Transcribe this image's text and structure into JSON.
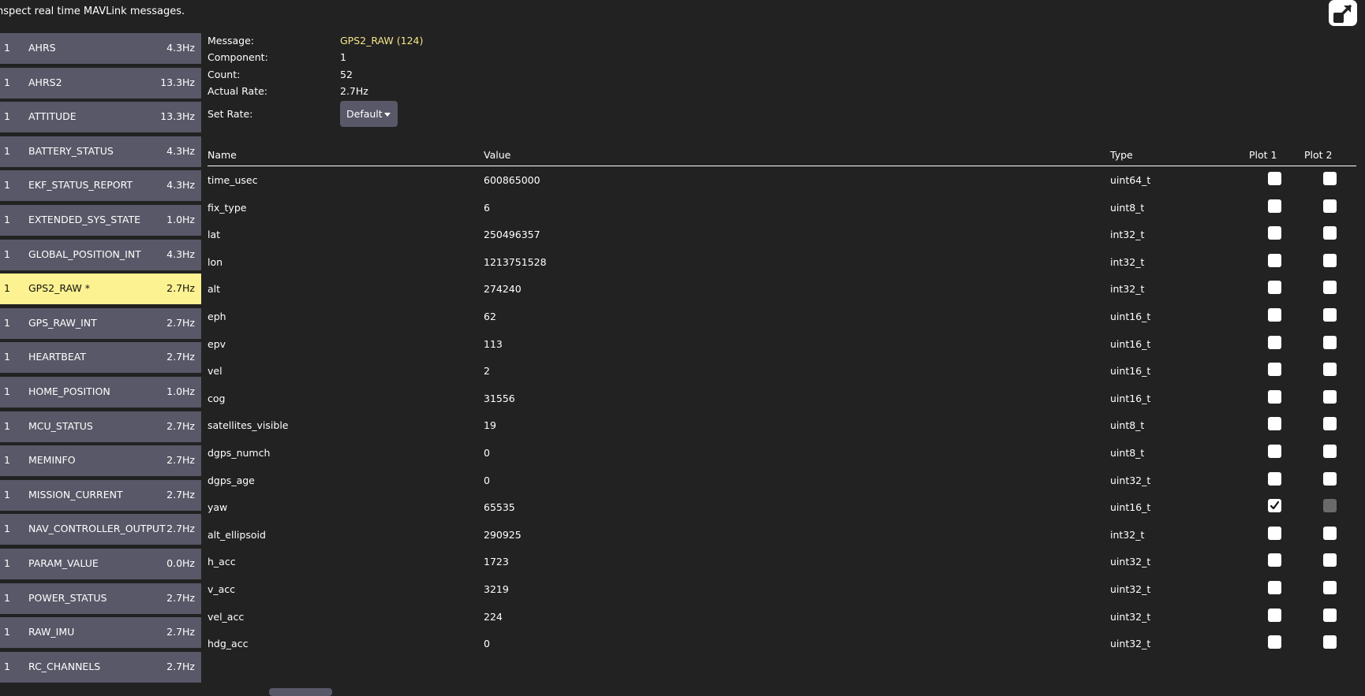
{
  "header": {
    "description": "nspect real time MAVLink messages."
  },
  "icons": {
    "popout": "popout-icon",
    "dropdown": "caret-down-icon",
    "check": "checkmark-icon"
  },
  "colors": {
    "background": "#222222",
    "item_bg": "#585868",
    "selected_bg": "#fdf291",
    "message_name": "#f5e58a"
  },
  "messages": [
    {
      "comp": "1",
      "name": "AHRS",
      "rate": "4.3Hz"
    },
    {
      "comp": "1",
      "name": "AHRS2",
      "rate": "13.3Hz"
    },
    {
      "comp": "1",
      "name": "ATTITUDE",
      "rate": "13.3Hz"
    },
    {
      "comp": "1",
      "name": "BATTERY_STATUS",
      "rate": "4.3Hz"
    },
    {
      "comp": "1",
      "name": "EKF_STATUS_REPORT",
      "rate": "4.3Hz"
    },
    {
      "comp": "1",
      "name": "EXTENDED_SYS_STATE",
      "rate": "1.0Hz"
    },
    {
      "comp": "1",
      "name": "GLOBAL_POSITION_INT",
      "rate": "4.3Hz"
    },
    {
      "comp": "1",
      "name": "GPS2_RAW *",
      "rate": "2.7Hz",
      "selected": true
    },
    {
      "comp": "1",
      "name": "GPS_RAW_INT",
      "rate": "2.7Hz"
    },
    {
      "comp": "1",
      "name": "HEARTBEAT",
      "rate": "2.7Hz"
    },
    {
      "comp": "1",
      "name": "HOME_POSITION",
      "rate": "1.0Hz"
    },
    {
      "comp": "1",
      "name": "MCU_STATUS",
      "rate": "2.7Hz"
    },
    {
      "comp": "1",
      "name": "MEMINFO",
      "rate": "2.7Hz"
    },
    {
      "comp": "1",
      "name": "MISSION_CURRENT",
      "rate": "2.7Hz"
    },
    {
      "comp": "1",
      "name": "NAV_CONTROLLER_OUTPUT",
      "rate": "2.7Hz"
    },
    {
      "comp": "1",
      "name": "PARAM_VALUE",
      "rate": "0.0Hz"
    },
    {
      "comp": "1",
      "name": "POWER_STATUS",
      "rate": "2.7Hz"
    },
    {
      "comp": "1",
      "name": "RAW_IMU",
      "rate": "2.7Hz"
    },
    {
      "comp": "1",
      "name": "RC_CHANNELS",
      "rate": "2.7Hz"
    }
  ],
  "info": {
    "message_label": "Message:",
    "message_value": "GPS2_RAW (124)",
    "component_label": "Component:",
    "component_value": "1",
    "count_label": "Count:",
    "count_value": "52",
    "actual_rate_label": "Actual Rate:",
    "actual_rate_value": "2.7Hz",
    "set_rate_label": "Set Rate:",
    "set_rate_value": "Default"
  },
  "table": {
    "headers": {
      "name": "Name",
      "value": "Value",
      "type": "Type",
      "plot1": "Plot 1",
      "plot2": "Plot 2"
    },
    "rows": [
      {
        "name": "time_usec",
        "value": "600865000",
        "type": "uint64_t",
        "plot1": false,
        "plot2": false
      },
      {
        "name": "fix_type",
        "value": "6",
        "type": "uint8_t",
        "plot1": false,
        "plot2": false
      },
      {
        "name": "lat",
        "value": "250496357",
        "type": "int32_t",
        "plot1": false,
        "plot2": false
      },
      {
        "name": "lon",
        "value": "1213751528",
        "type": "int32_t",
        "plot1": false,
        "plot2": false
      },
      {
        "name": "alt",
        "value": "274240",
        "type": "int32_t",
        "plot1": false,
        "plot2": false
      },
      {
        "name": "eph",
        "value": "62",
        "type": "uint16_t",
        "plot1": false,
        "plot2": false
      },
      {
        "name": "epv",
        "value": "113",
        "type": "uint16_t",
        "plot1": false,
        "plot2": false
      },
      {
        "name": "vel",
        "value": "2",
        "type": "uint16_t",
        "plot1": false,
        "plot2": false
      },
      {
        "name": "cog",
        "value": "31556",
        "type": "uint16_t",
        "plot1": false,
        "plot2": false
      },
      {
        "name": "satellites_visible",
        "value": "19",
        "type": "uint8_t",
        "plot1": false,
        "plot2": false
      },
      {
        "name": "dgps_numch",
        "value": "0",
        "type": "uint8_t",
        "plot1": false,
        "plot2": false
      },
      {
        "name": "dgps_age",
        "value": "0",
        "type": "uint32_t",
        "plot1": false,
        "plot2": false
      },
      {
        "name": "yaw",
        "value": "65535",
        "type": "uint16_t",
        "plot1": true,
        "plot2": false,
        "plot2_disabled": true
      },
      {
        "name": "alt_ellipsoid",
        "value": "290925",
        "type": "int32_t",
        "plot1": false,
        "plot2": false
      },
      {
        "name": "h_acc",
        "value": "1723",
        "type": "uint32_t",
        "plot1": false,
        "plot2": false
      },
      {
        "name": "v_acc",
        "value": "3219",
        "type": "uint32_t",
        "plot1": false,
        "plot2": false
      },
      {
        "name": "vel_acc",
        "value": "224",
        "type": "uint32_t",
        "plot1": false,
        "plot2": false
      },
      {
        "name": "hdg_acc",
        "value": "0",
        "type": "uint32_t",
        "plot1": false,
        "plot2": false
      }
    ]
  }
}
